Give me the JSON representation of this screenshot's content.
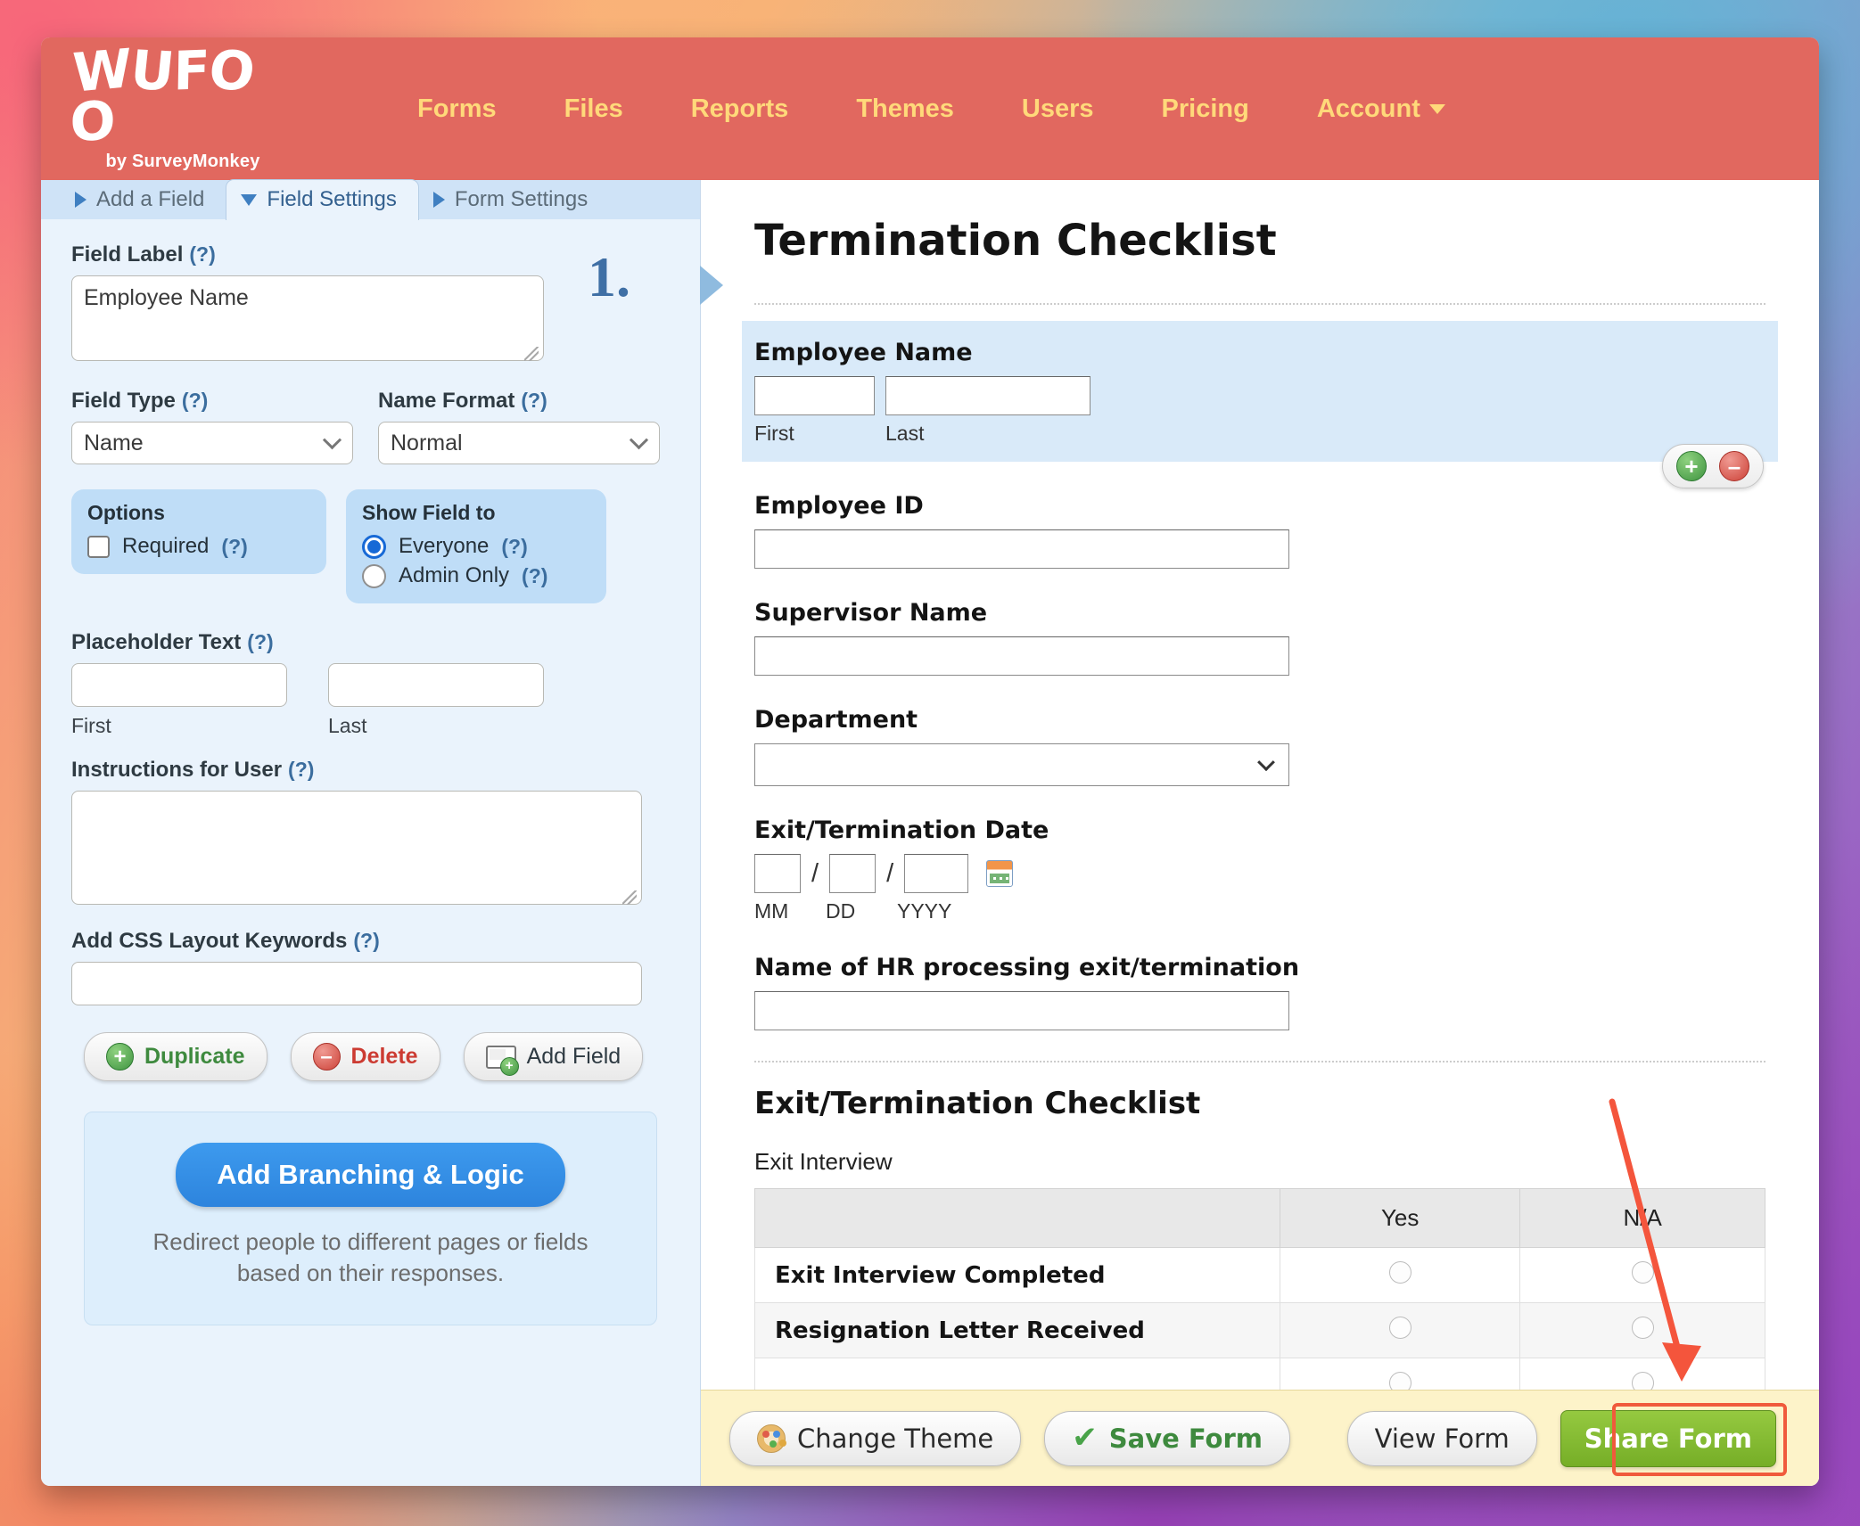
{
  "brand": {
    "logo_text": "WUFOO",
    "logo_subtitle": "by SurveyMonkey",
    "header_bg": "#e1685f",
    "nav_color": "#ffd97a"
  },
  "nav": {
    "items": [
      {
        "label": "Forms"
      },
      {
        "label": "Files"
      },
      {
        "label": "Reports"
      },
      {
        "label": "Themes"
      },
      {
        "label": "Users"
      },
      {
        "label": "Pricing"
      },
      {
        "label": "Account"
      }
    ],
    "account_caret": "caret-down-icon"
  },
  "left_panel": {
    "tabs": [
      {
        "label": "Add a Field",
        "state": "collapsed",
        "marker": "triangle-right"
      },
      {
        "label": "Field Settings",
        "state": "active",
        "marker": "triangle-down"
      },
      {
        "label": "Form Settings",
        "state": "collapsed",
        "marker": "triangle-right"
      }
    ],
    "field_number": "1.",
    "field_label": {
      "label": "Field Label",
      "help": "(?)",
      "value": "Employee Name"
    },
    "field_type": {
      "label": "Field Type",
      "help": "(?)",
      "value": "Name",
      "options": [
        "Name"
      ]
    },
    "name_format": {
      "label": "Name Format",
      "help": "(?)",
      "value": "Normal",
      "options": [
        "Normal"
      ]
    },
    "options_group": {
      "title": "Options",
      "required_label": "Required",
      "required_help": "(?)",
      "required_checked": false
    },
    "show_field_group": {
      "title": "Show Field to",
      "choices": [
        {
          "label": "Everyone",
          "help": "(?)",
          "selected": true
        },
        {
          "label": "Admin Only",
          "help": "(?)",
          "selected": false
        }
      ]
    },
    "placeholder_text": {
      "label": "Placeholder Text",
      "help": "(?)",
      "first_value": "",
      "first_caption": "First",
      "last_value": "",
      "last_caption": "Last"
    },
    "instructions": {
      "label": "Instructions for User",
      "help": "(?)",
      "value": ""
    },
    "css_keywords": {
      "label": "Add CSS Layout Keywords",
      "help": "(?)",
      "value": ""
    },
    "actions": {
      "duplicate": "Duplicate",
      "delete": "Delete",
      "add_field": "Add Field"
    },
    "branching": {
      "button": "Add Branching & Logic",
      "description": "Redirect people to different pages or fields based on their responses."
    }
  },
  "form_preview": {
    "title": "Termination Checklist",
    "fields": [
      {
        "label": "Employee Name",
        "type": "name",
        "selected": true,
        "sub_captions": [
          "First",
          "Last"
        ]
      },
      {
        "label": "Employee ID",
        "type": "text"
      },
      {
        "label": "Supervisor Name",
        "type": "text"
      },
      {
        "label": "Department",
        "type": "select",
        "value": ""
      },
      {
        "label": "Exit/Termination Date",
        "type": "date",
        "sub_captions": [
          "MM",
          "DD",
          "YYYY"
        ],
        "calendar_icon": "calendar-icon"
      },
      {
        "label": "Name of HR processing exit/termination",
        "type": "text"
      }
    ],
    "section": {
      "heading": "Exit/Termination Checklist",
      "likert_label": "Exit Interview",
      "columns": [
        "",
        "Yes",
        "N/A"
      ],
      "rows": [
        {
          "label": "Exit Interview Completed",
          "values": [
            "",
            ""
          ]
        },
        {
          "label": "Resignation Letter Received",
          "values": [
            "",
            ""
          ]
        }
      ]
    },
    "field_controls": {
      "add": "add-field-icon",
      "remove": "remove-field-icon"
    }
  },
  "toolbar": {
    "change_theme": "Change Theme",
    "save_form": "Save Form",
    "view_form": "View Form",
    "share_form": "Share Form",
    "share_highlight_color": "#f05a3c"
  }
}
